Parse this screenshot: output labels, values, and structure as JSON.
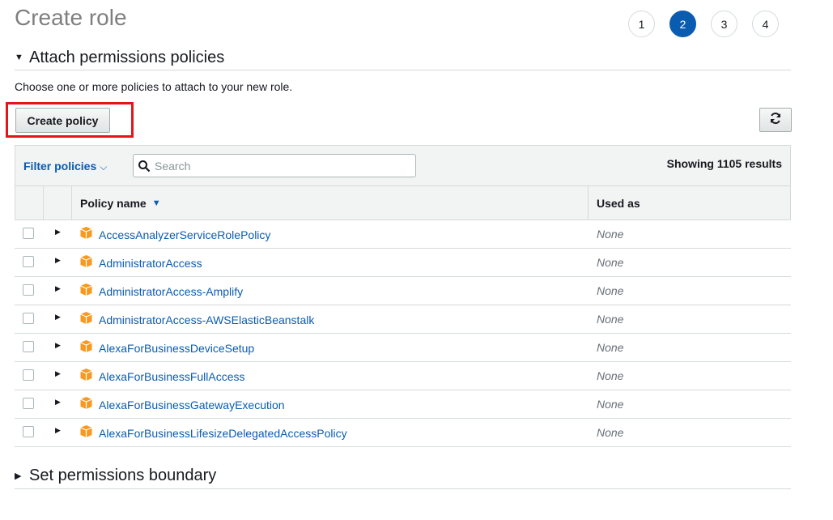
{
  "page": {
    "title": "Create role"
  },
  "steps": [
    "1",
    "2",
    "3",
    "4"
  ],
  "active_step": "2",
  "section_attach": {
    "title": "Attach permissions policies",
    "description": "Choose one or more policies to attach to your new role."
  },
  "toolbar": {
    "create_policy_label": "Create policy",
    "refresh_icon": "refresh-icon"
  },
  "filter": {
    "label": "Filter policies",
    "placeholder": "Search",
    "value": "",
    "results_text": "Showing 1105 results"
  },
  "table": {
    "columns": {
      "policy_name": "Policy name",
      "used_as": "Used as"
    },
    "rows": [
      {
        "name": "AccessAnalyzerServiceRolePolicy",
        "used_as": "None"
      },
      {
        "name": "AdministratorAccess",
        "used_as": "None"
      },
      {
        "name": "AdministratorAccess-Amplify",
        "used_as": "None"
      },
      {
        "name": "AdministratorAccess-AWSElasticBeanstalk",
        "used_as": "None"
      },
      {
        "name": "AlexaForBusinessDeviceSetup",
        "used_as": "None"
      },
      {
        "name": "AlexaForBusinessFullAccess",
        "used_as": "None"
      },
      {
        "name": "AlexaForBusinessGatewayExecution",
        "used_as": "None"
      },
      {
        "name": "AlexaForBusinessLifesizeDelegatedAccessPolicy",
        "used_as": "None"
      }
    ]
  },
  "section_boundary": {
    "title": "Set permissions boundary"
  },
  "colors": {
    "link": "#0a5cb0",
    "active_step": "#0a5cb0",
    "highlight": "#e4141b",
    "policy_icon": "#f7981f"
  }
}
